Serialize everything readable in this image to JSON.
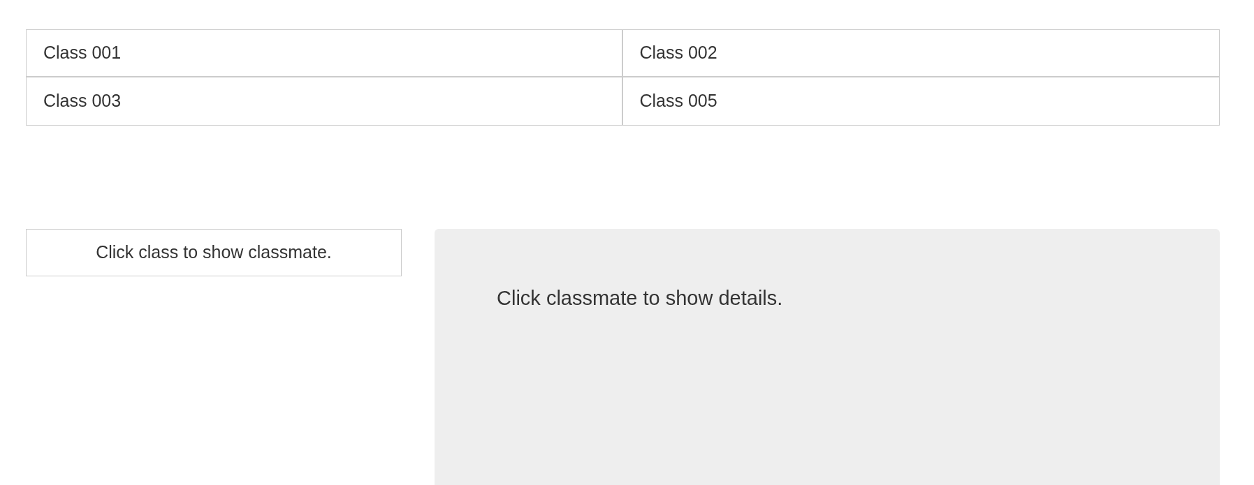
{
  "classes": [
    {
      "label": "Class 001"
    },
    {
      "label": "Class 002"
    },
    {
      "label": "Class 003"
    },
    {
      "label": "Class 005"
    }
  ],
  "classmate_list": {
    "message": "Click class to show classmate."
  },
  "details_panel": {
    "message": "Click classmate to show details."
  }
}
